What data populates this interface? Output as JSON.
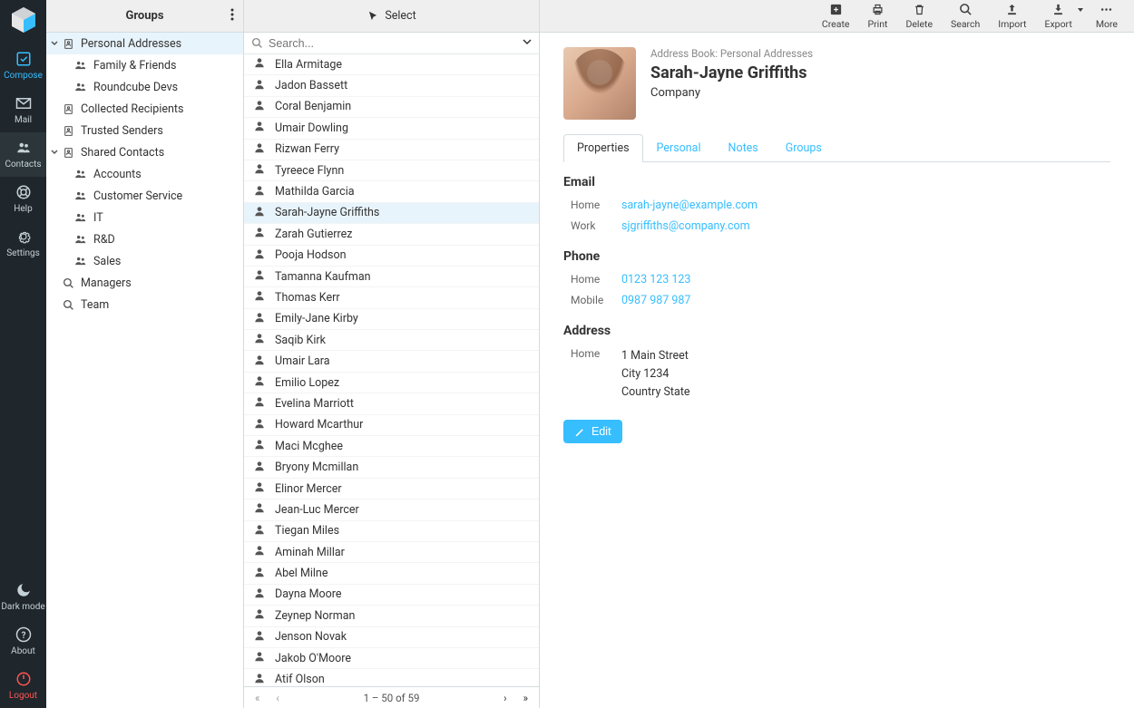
{
  "taskmenu": {
    "compose": "Compose",
    "mail": "Mail",
    "contacts": "Contacts",
    "help": "Help",
    "settings": "Settings",
    "darkmode": "Dark mode",
    "about": "About",
    "logout": "Logout"
  },
  "groups": {
    "title": "Groups",
    "items": [
      {
        "label": "Personal Addresses",
        "type": "book",
        "level": 0,
        "expanded": true,
        "selected": true
      },
      {
        "label": "Family & Friends",
        "type": "group",
        "level": 1
      },
      {
        "label": "Roundcube Devs",
        "type": "group",
        "level": 1
      },
      {
        "label": "Collected Recipients",
        "type": "book",
        "level": 0
      },
      {
        "label": "Trusted Senders",
        "type": "book",
        "level": 0
      },
      {
        "label": "Shared Contacts",
        "type": "book",
        "level": 0,
        "expanded": true
      },
      {
        "label": "Accounts",
        "type": "group",
        "level": 1
      },
      {
        "label": "Customer Service",
        "type": "group",
        "level": 1
      },
      {
        "label": "IT",
        "type": "group",
        "level": 1
      },
      {
        "label": "R&D",
        "type": "group",
        "level": 1
      },
      {
        "label": "Sales",
        "type": "group",
        "level": 1
      },
      {
        "label": "Managers",
        "type": "search",
        "level": 0
      },
      {
        "label": "Team",
        "type": "search",
        "level": 0
      }
    ]
  },
  "contacts": {
    "select_label": "Select",
    "search_placeholder": "Search...",
    "pagination": "1 – 50 of 59",
    "list": [
      "Ella Armitage",
      "Jadon Bassett",
      "Coral Benjamin",
      "Umair Dowling",
      "Rizwan Ferry",
      "Tyreece Flynn",
      "Mathilda Garcia",
      "Sarah-Jayne Griffiths",
      "Zarah Gutierrez",
      "Pooja Hodson",
      "Tamanna Kaufman",
      "Thomas Kerr",
      "Emily-Jane Kirby",
      "Saqib Kirk",
      "Umair Lara",
      "Emilio Lopez",
      "Evelina Marriott",
      "Howard Mcarthur",
      "Maci Mcghee",
      "Bryony Mcmillan",
      "Elinor Mercer",
      "Jean-Luc Mercer",
      "Tiegan Miles",
      "Aminah Millar",
      "Abel Milne",
      "Dayna Moore",
      "Zeynep Norman",
      "Jenson Novak",
      "Jakob O'Moore",
      "Atif Olson"
    ],
    "selected_index": 7
  },
  "toolbar": {
    "create": "Create",
    "print": "Print",
    "delete": "Delete",
    "search": "Search",
    "import": "Import",
    "export": "Export",
    "more": "More"
  },
  "detail": {
    "source_prefix": "Address Book: ",
    "source_name": "Personal Addresses",
    "name": "Sarah-Jayne Griffiths",
    "company": "Company",
    "tabs": [
      "Properties",
      "Personal",
      "Notes",
      "Groups"
    ],
    "active_tab": 0,
    "sections": {
      "email": {
        "title": "Email",
        "rows": [
          {
            "label": "Home",
            "value": "sarah-jayne@example.com",
            "link": true
          },
          {
            "label": "Work",
            "value": "sjgriffiths@company.com",
            "link": true
          }
        ]
      },
      "phone": {
        "title": "Phone",
        "rows": [
          {
            "label": "Home",
            "value": "0123 123 123",
            "link": true
          },
          {
            "label": "Mobile",
            "value": "0987 987 987",
            "link": true
          }
        ]
      },
      "address": {
        "title": "Address",
        "rows": [
          {
            "label": "Home",
            "value": "1 Main Street\nCity 1234\nCountry State",
            "link": false
          }
        ]
      }
    },
    "edit_label": "Edit"
  }
}
